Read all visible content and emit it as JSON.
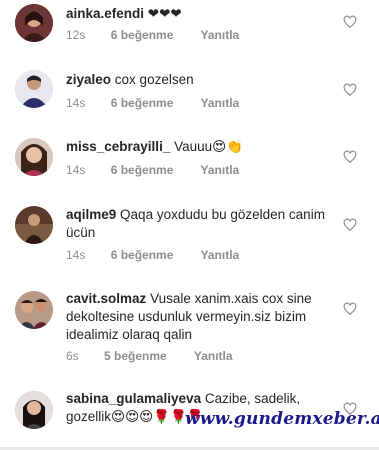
{
  "comments": [
    {
      "user": "ainka.efendi",
      "text": "❤❤❤",
      "time": "12s",
      "likes": "6 beğenme",
      "reply": "Yanıtla"
    },
    {
      "user": "ziyaleo",
      "text": "cox gozelsen",
      "time": "14s",
      "likes": "6 beğenme",
      "reply": "Yanıtla"
    },
    {
      "user": "miss_cebrayilli_",
      "text": "Vauuu😍👏",
      "time": "14s",
      "likes": "6 beğenme",
      "reply": "Yanıtla"
    },
    {
      "user": "aqilme9",
      "text": "Qaqa yoxdudu bu gözelden canim ücün",
      "time": "14s",
      "likes": "6 beğenme",
      "reply": "Yanıtla"
    },
    {
      "user": "cavit.solmaz",
      "text": "Vusale xanim.xais cox sine dekoltesine usdunluk vermeyin.siz bizim idealimiz olaraq qalin",
      "time": "6s",
      "likes": "5 beğenme",
      "reply": "Yanıtla"
    },
    {
      "user": "sabina_gulamaliyeva",
      "text": "Cazibe, sadelik, gozellik😍😍😍🌹🌹🌹"
    }
  ],
  "watermark": "www.gundemxeber.az",
  "colors": {
    "meta": "#8e8e8e",
    "text": "#262626",
    "watermark": "#1a1a8c"
  },
  "icons": {
    "like": "heart-outline-icon"
  }
}
